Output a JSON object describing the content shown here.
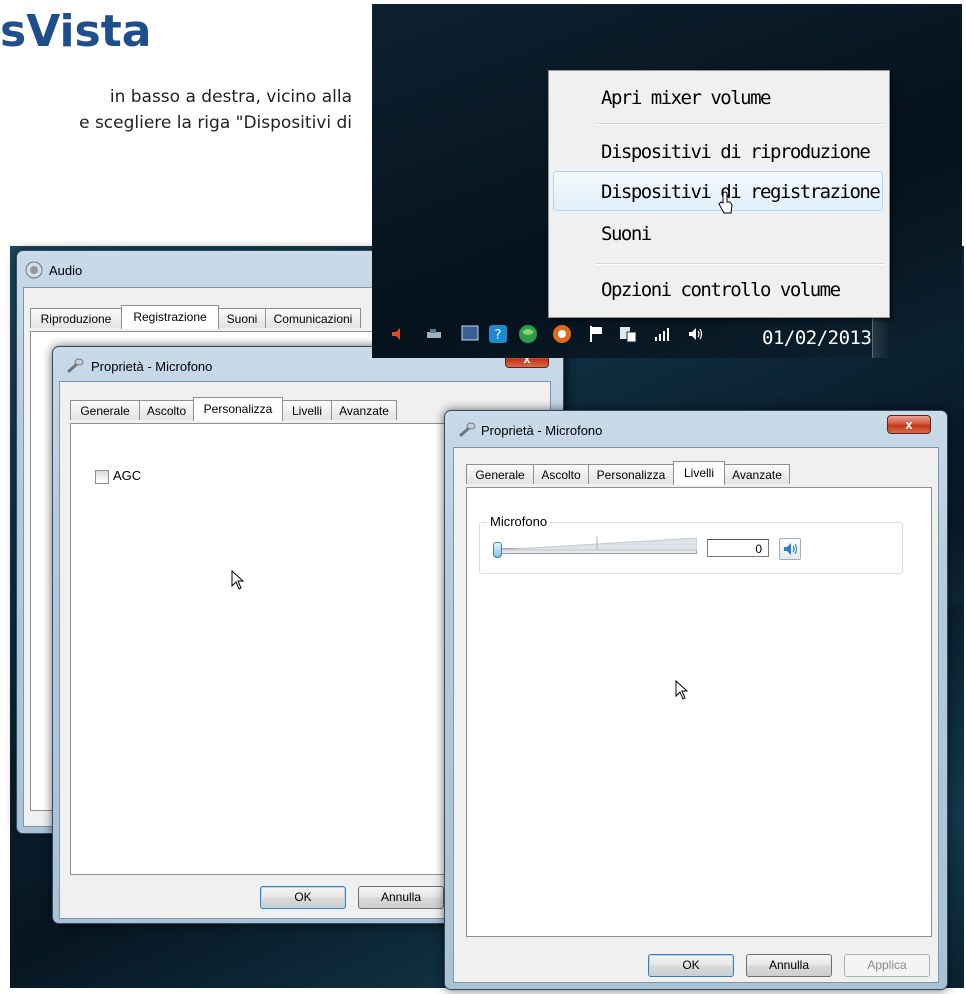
{
  "doc": {
    "title": "sVista",
    "paragraph_line1": "in basso a destra, vicino alla",
    "paragraph_line2": "e scegliere la riga \"Dispositivi di"
  },
  "audio_window": {
    "title": "Audio",
    "tabs": [
      "Riproduzione",
      "Registrazione",
      "Suoni",
      "Comunicazioni"
    ],
    "active_tab": "Registrazione"
  },
  "props_left": {
    "title": "Proprietà - Microfono",
    "tabs": [
      "Generale",
      "Ascolto",
      "Personalizza",
      "Livelli",
      "Avanzate"
    ],
    "active_tab": "Personalizza",
    "agc_label": "AGC",
    "ok_label": "OK",
    "cancel_label": "Annulla",
    "close_label": "x"
  },
  "props_right": {
    "title": "Proprietà - Microfono",
    "tabs": [
      "Generale",
      "Ascolto",
      "Personalizza",
      "Livelli",
      "Avanzate"
    ],
    "active_tab": "Livelli",
    "group_label": "Microfono",
    "level_value": "0",
    "level_fraction": 0,
    "ok_label": "OK",
    "cancel_label": "Annulla",
    "apply_label": "Applica",
    "close_label": "x"
  },
  "context_menu": {
    "items": [
      "Apri mixer volume",
      "Dispositivi di riproduzione",
      "Dispositivi di registrazione",
      "Suoni",
      "Opzioni controllo volume"
    ],
    "highlighted_item": "Dispositivi di registrazione"
  },
  "taskbar": {
    "date": "01/02/2013",
    "tray_icons": [
      "speaker-icon",
      "network-icon",
      "display-icon",
      "wireless-icon",
      "globe-icon",
      "antivirus-icon",
      "flag-icon",
      "monitor-icon",
      "signal-bars-icon",
      "volume-icon"
    ]
  }
}
